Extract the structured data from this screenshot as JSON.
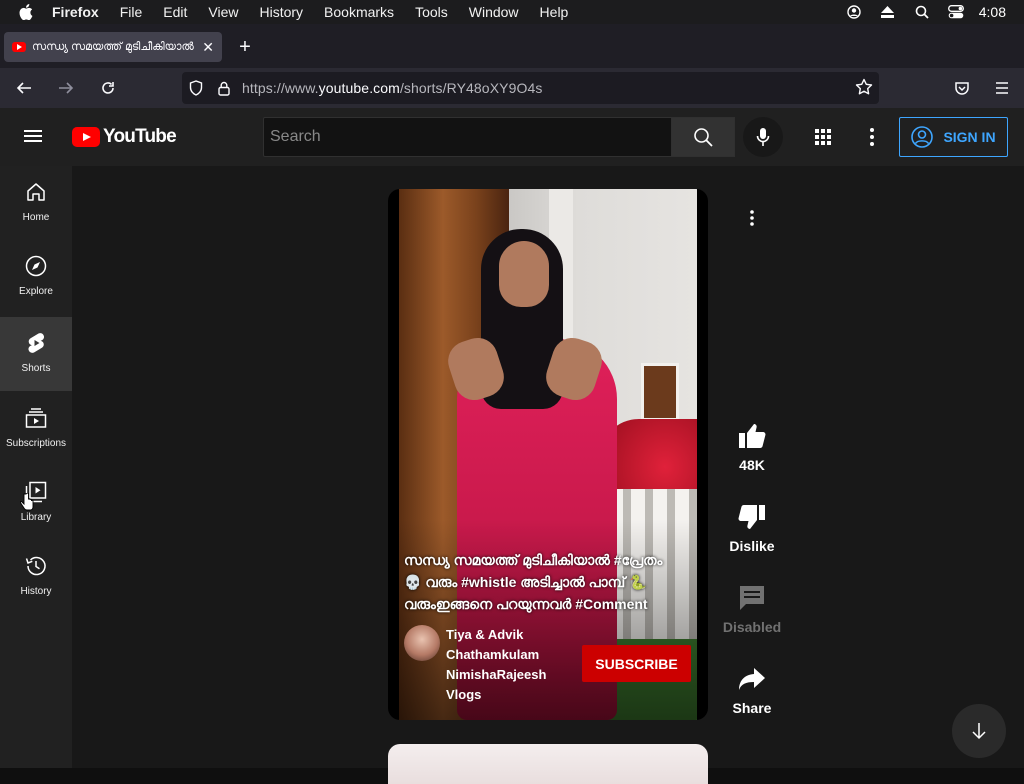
{
  "menubar": {
    "app": "Firefox",
    "items": [
      "File",
      "Edit",
      "View",
      "History",
      "Bookmarks",
      "Tools",
      "Window",
      "Help"
    ],
    "time": "4:08"
  },
  "browser": {
    "tab_title": "സന്ധ്യ സമയത്ത് മുടിചീകിയാൽ #പ്രേ",
    "url_prefix": "https://www.",
    "url_domain": "youtube.com",
    "url_path": "/shorts/RY48oXY9O4s"
  },
  "youtube": {
    "logo_text": "YouTube",
    "search_placeholder": "Search",
    "sign_in": "SIGN IN",
    "sidebar": [
      {
        "label": "Home",
        "icon": "home-icon"
      },
      {
        "label": "Explore",
        "icon": "compass-icon"
      },
      {
        "label": "Shorts",
        "icon": "shorts-icon",
        "active": true
      },
      {
        "label": "Subscriptions",
        "icon": "subscriptions-icon"
      },
      {
        "label": "Library",
        "icon": "library-icon"
      },
      {
        "label": "History",
        "icon": "history-icon"
      }
    ]
  },
  "short": {
    "caption_line1": "സന്ധ്യ സമയത്ത് മുടിചീകിയാൽ #പ്രേതം",
    "caption_line2": "💀 വരും #whistle അടിച്ചാൽ പാമ്പ് 🐍",
    "caption_line3": "വരുംഇങ്ങനെ പറയുന്നവർ #Comment",
    "channel_name": "Tiya & Advik Chathamkulam NimishaRajeesh Vlogs",
    "subscribe_label": "SUBSCRIBE"
  },
  "actions": {
    "likes": "48K",
    "dislike": "Dislike",
    "comments": "Disabled",
    "share": "Share"
  },
  "colors": {
    "accent_blue": "#3ea6ff",
    "brand_red": "#ff0000",
    "subscribe_red": "#cc0000"
  }
}
